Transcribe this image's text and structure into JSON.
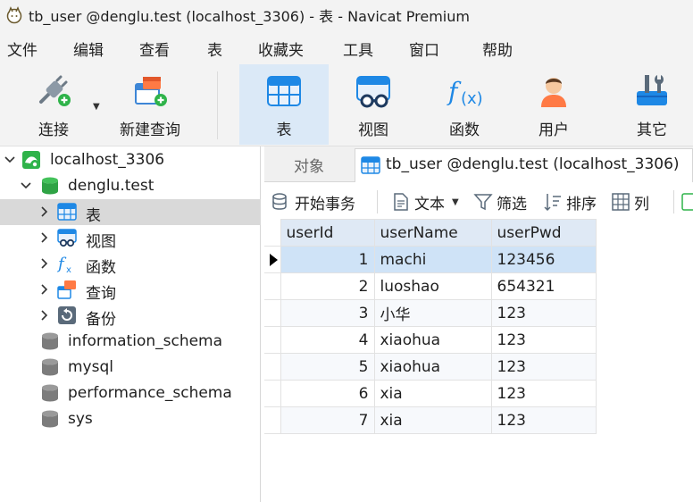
{
  "window": {
    "title": "tb_user @denglu.test (localhost_3306) - 表 - Navicat Premium"
  },
  "menu": [
    "文件",
    "编辑",
    "查看",
    "表",
    "收藏夹",
    "工具",
    "窗口",
    "帮助"
  ],
  "toolbar": {
    "connect": "连接",
    "new_query": "新建查询",
    "table": "表",
    "view": "视图",
    "function": "函数",
    "user": "用户",
    "other": "其它"
  },
  "navigator": {
    "connection": "localhost_3306",
    "database": "denglu.test",
    "db_items": [
      "表",
      "视图",
      "函数",
      "查询",
      "备份"
    ],
    "other_databases": [
      "information_schema",
      "mysql",
      "performance_schema",
      "sys"
    ]
  },
  "tabs": {
    "objects": "对象",
    "active": "tb_user @denglu.test (localhost_3306)"
  },
  "data_toolbar": {
    "begin_transaction": "开始事务",
    "text": "文本",
    "filter": "筛选",
    "sort": "排序",
    "columns": "列"
  },
  "grid": {
    "columns": [
      "userId",
      "userName",
      "userPwd"
    ],
    "rows": [
      [
        "1",
        "machi",
        "123456"
      ],
      [
        "2",
        "luoshao",
        "654321"
      ],
      [
        "3",
        "小华",
        "123"
      ],
      [
        "4",
        "xiaohua",
        "123"
      ],
      [
        "5",
        "xiaohua",
        "123"
      ],
      [
        "6",
        "xia",
        "123"
      ],
      [
        "7",
        "xia",
        "123"
      ]
    ]
  },
  "colors": {
    "accent": "#1e88e5",
    "selection": "#cfe3f7",
    "header": "#dfe9f5",
    "nav_selected": "#d9d9d9"
  }
}
